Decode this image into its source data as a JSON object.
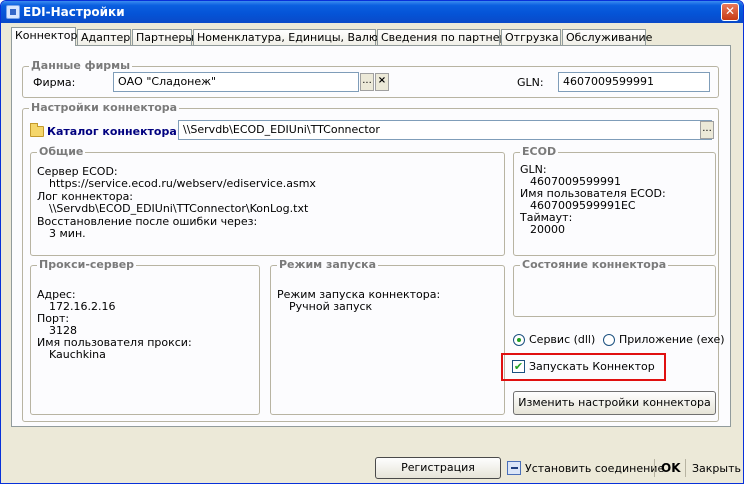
{
  "window": {
    "title": "EDI-Настройки"
  },
  "tabs": [
    "Коннектор",
    "Адаптер",
    "Партнеры",
    "Номенклатура, Единицы, Валюты",
    "Сведения по партнеру",
    "Отгрузка",
    "Обслуживание"
  ],
  "firm_group": {
    "title": "Данные фирмы",
    "firm_label": "Фирма:",
    "firm_value": "ОАО \"Сладонеж\"",
    "browse": "...",
    "clear": "×",
    "gln_label": "GLN:",
    "gln_value": "4607009599991"
  },
  "connector_group": {
    "title": "Настройки коннектора",
    "catalog_label": "Каталог коннектора:",
    "catalog_value": "\\\\Servdb\\ECOD_EDIUni\\TTConnector",
    "browse": "..."
  },
  "general": {
    "title": "Общие",
    "server_label": "Сервер ECOD:",
    "server_value": "https://service.ecod.ru/webserv/ediservice.asmx",
    "log_label": "Лог коннектора:",
    "log_value": "\\\\Servdb\\ECOD_EDIUni\\TTConnector\\KonLog.txt",
    "recovery_label": "Восстановление после ошибки через:",
    "recovery_value": "3 мин."
  },
  "ecod": {
    "title": "ECOD",
    "gln_label": "GLN:",
    "gln_value": "4607009599991",
    "user_label": "Имя пользователя ECOD:",
    "user_value": "4607009599991EC",
    "timeout_label": "Таймаут:",
    "timeout_value": "20000"
  },
  "proxy": {
    "title": "Прокси-сервер",
    "address_label": "Адрес:",
    "address_value": "172.16.2.16",
    "port_label": "Порт:",
    "port_value": "3128",
    "user_label": "Имя пользователя прокси:",
    "user_value": "Kauchkina"
  },
  "launch": {
    "title": "Режим запуска",
    "mode_label": "Режим запуска коннектора:",
    "mode_value": "Ручной запуск"
  },
  "state": {
    "title": "Состояние коннектора"
  },
  "options": {
    "service_label": "Сервис (dll)",
    "app_label": "Приложение (exe)",
    "run_label": "Запускать Коннектор",
    "change_button": "Изменить настройки коннектора"
  },
  "bottom": {
    "register": "Регистрация TTConn.dll",
    "connect": "Установить соединение",
    "ok": "OK",
    "close": "Закрыть"
  },
  "colors": {
    "titlebar": "#0553d6",
    "highlight": "#e01010",
    "label_blue": "#00007f"
  }
}
